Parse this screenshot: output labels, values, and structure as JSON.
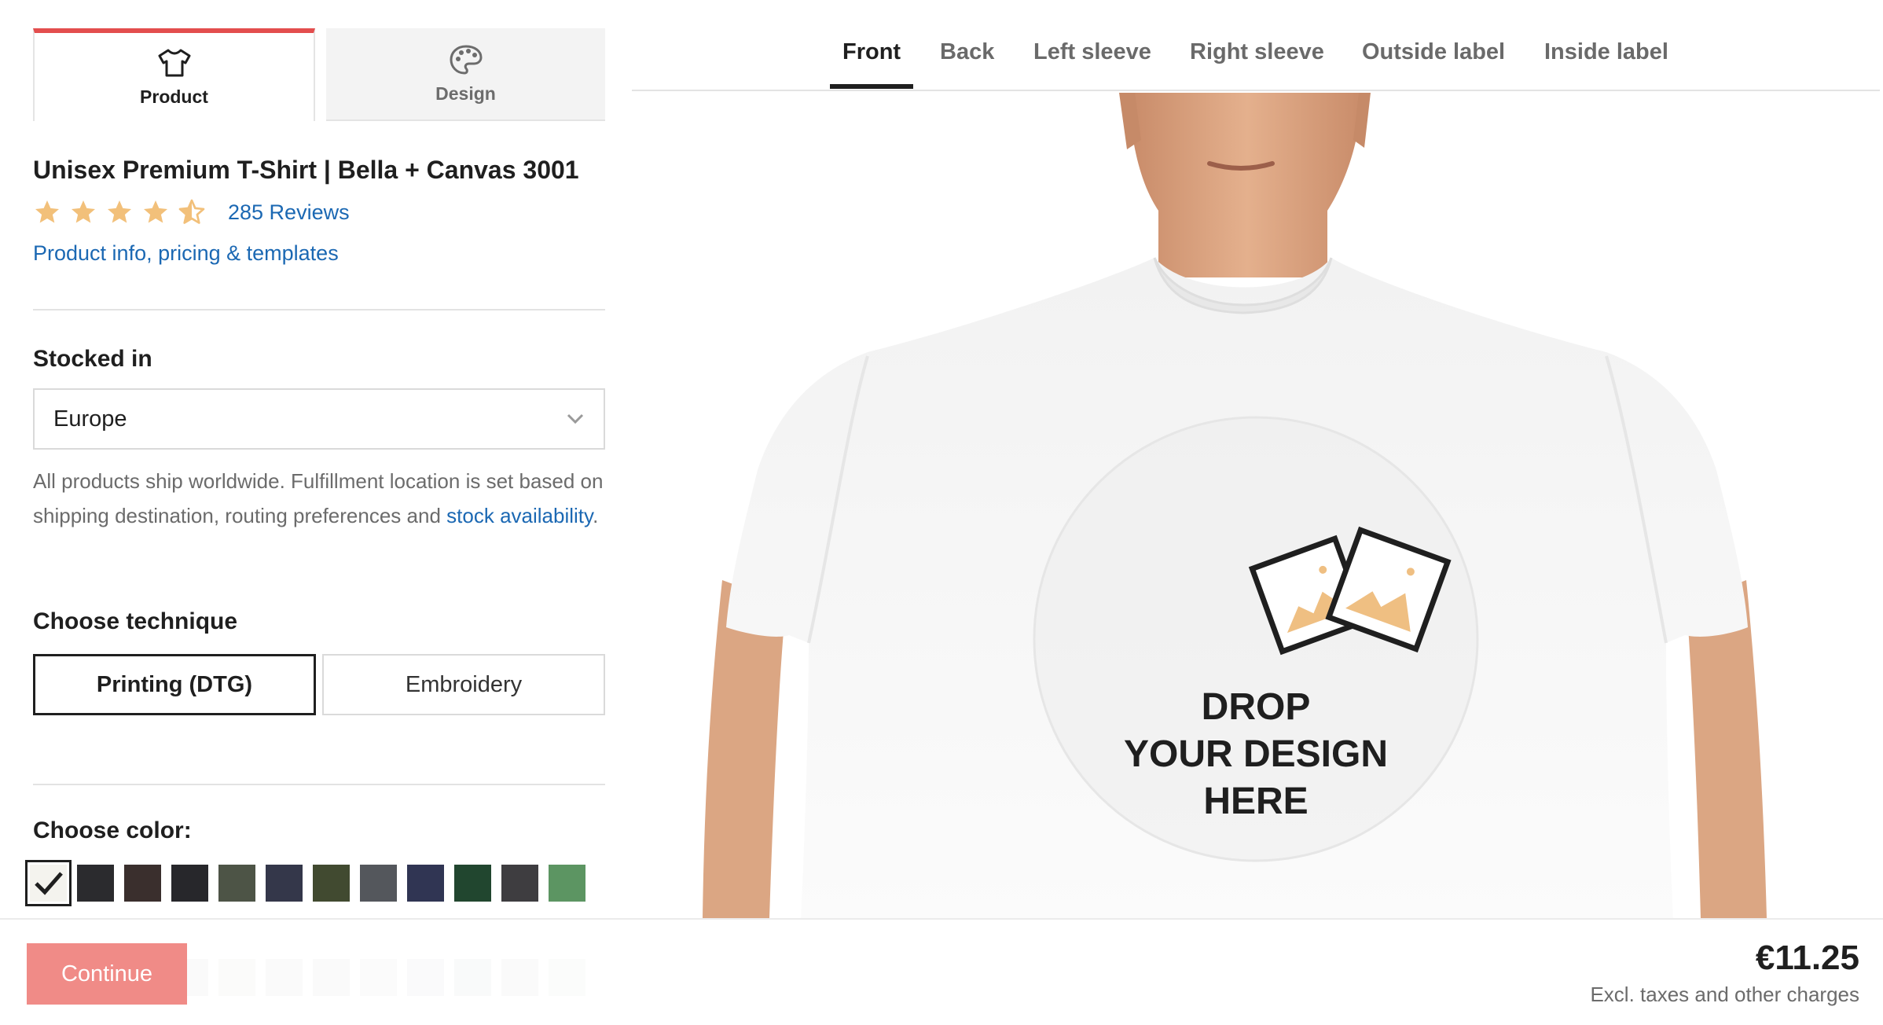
{
  "left_tabs": [
    {
      "label": "Product",
      "icon": "tshirt-icon",
      "active": true
    },
    {
      "label": "Design",
      "icon": "palette-icon",
      "active": false
    }
  ],
  "product": {
    "title": "Unisex Premium T-Shirt | Bella + Canvas 3001",
    "rating": 4.5,
    "rating_max": 5,
    "reviews": "285 Reviews",
    "info_link": "Product info, pricing & templates"
  },
  "stock": {
    "label": "Stocked in",
    "selected": "Europe",
    "note": "All products ship worldwide. Fulfillment location is set based on shipping destination, routing preferences and",
    "note_link": "stock availability",
    "note_end": "."
  },
  "technique": {
    "label": "Choose technique",
    "options": [
      "Printing (DTG)",
      "Embroidery"
    ],
    "selected": "Printing (DTG)"
  },
  "color": {
    "label": "Choose color:",
    "swatches": [
      "#f4f3ee",
      "#2b2b2e",
      "#3a2f2d",
      "#27272b",
      "#4d5446",
      "#34374a",
      "#414a30",
      "#54575c",
      "#303553",
      "#21462f",
      "#3e3d40",
      "#5c9562"
    ],
    "selected_index": 0
  },
  "view_tabs": [
    "Front",
    "Back",
    "Left sleeve",
    "Right sleeve",
    "Outside label",
    "Inside label"
  ],
  "active_view": "Front",
  "drop_zone": {
    "line1": "DROP",
    "line2": "YOUR DESIGN",
    "line3": "HERE"
  },
  "footer": {
    "continue_label": "Continue",
    "price": "€11.25",
    "price_note": "Excl. taxes and other charges"
  },
  "colors": {
    "accent": "#e34e4e",
    "link": "#1b68b3",
    "star": "#f2c07a",
    "continue_bg": "#f08b87"
  }
}
